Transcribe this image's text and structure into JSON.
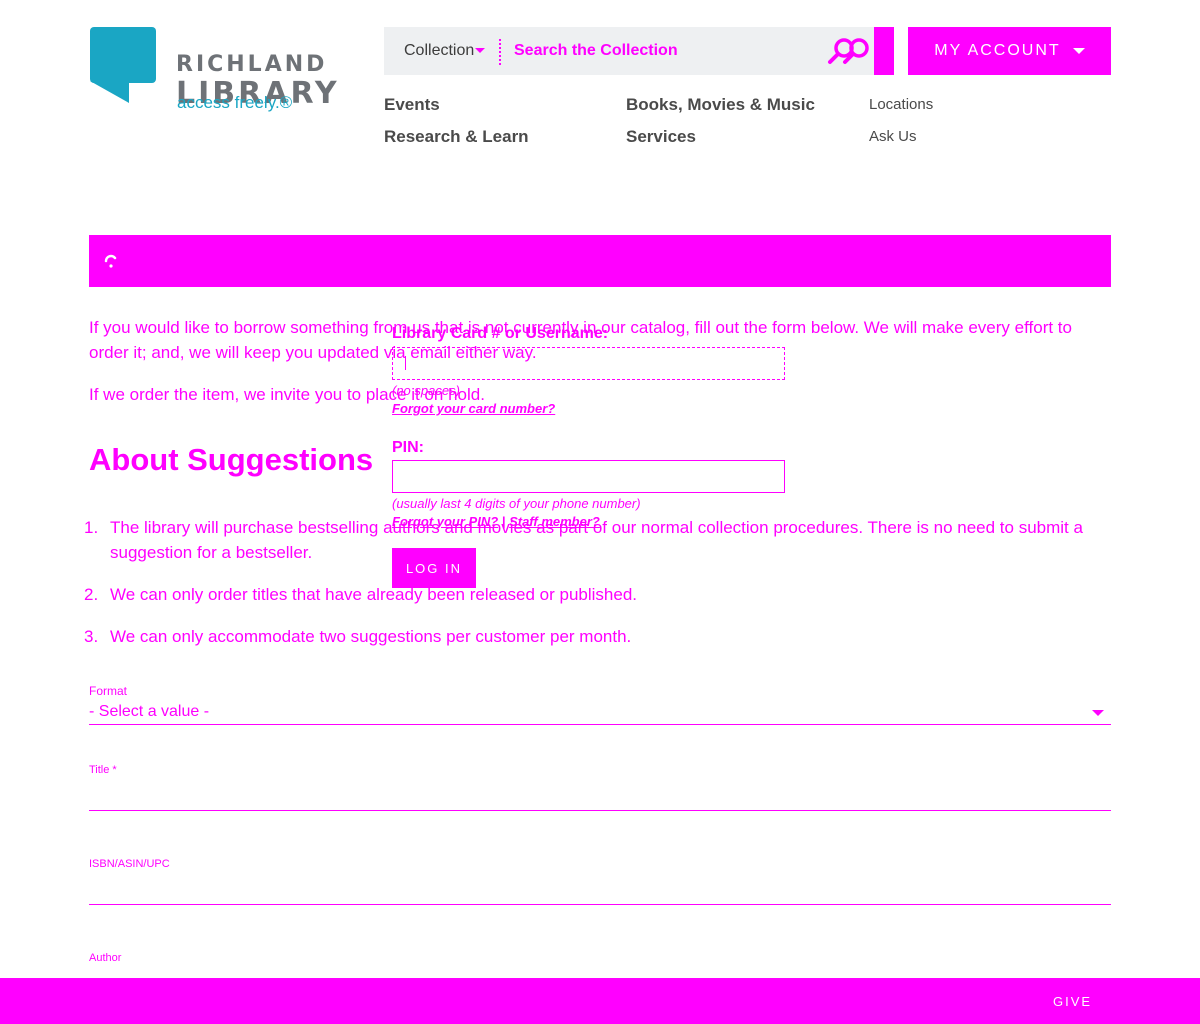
{
  "logo": {
    "name_line1": "RICHLAND",
    "name_line2": "LIBRARY",
    "tagline": "access freely.®"
  },
  "search": {
    "scope": "Collection",
    "placeholder": "Search the Collection"
  },
  "account": {
    "label": "MY ACCOUNT"
  },
  "nav": {
    "events": "Events",
    "research": "Research & Learn",
    "books": "Books, Movies & Music",
    "services": "Services",
    "locations": "Locations",
    "ask_us": "Ask Us"
  },
  "intro": {
    "para1": "If you would like to borrow something from us that is not currently in our catalog, fill out the form below. We will make every effort to order it; and, we will keep you updated via email either way.",
    "para2": "If we order the item, we invite you to place it on hold."
  },
  "about": {
    "heading": "About Suggestions",
    "items": [
      {
        "num": "1.",
        "text": "The library will purchase bestselling authors and movies as part of our normal collection procedures. There is no need to submit a suggestion for a bestseller."
      },
      {
        "num": "2.",
        "text": "We can only order titles that have already been released or published."
      },
      {
        "num": "3.",
        "text": "We can only accommodate two suggestions per customer per month."
      }
    ]
  },
  "login": {
    "card_label": "Library Card # or Username:",
    "card_hint": "(no spaces)",
    "card_forgot": "Forgot your card number?",
    "pin_label": "PIN:",
    "pin_hint": "(usually last 4 digits of your phone number)",
    "pin_forgot": "Forgot your PIN?",
    "separator": "|",
    "staff_link": "Staff member?",
    "button": "LOG IN"
  },
  "form": {
    "format_label": "Format",
    "format_value": "- Select a value -",
    "title_label": "Title *",
    "isbn_label": "ISBN/ASIN/UPC",
    "author_label": "Author"
  },
  "footer": {
    "give": "GIVE"
  },
  "colors": {
    "accent": "#ff00ff",
    "logo_blue": "#1aa6c4",
    "logo_gray": "#6e7277"
  }
}
